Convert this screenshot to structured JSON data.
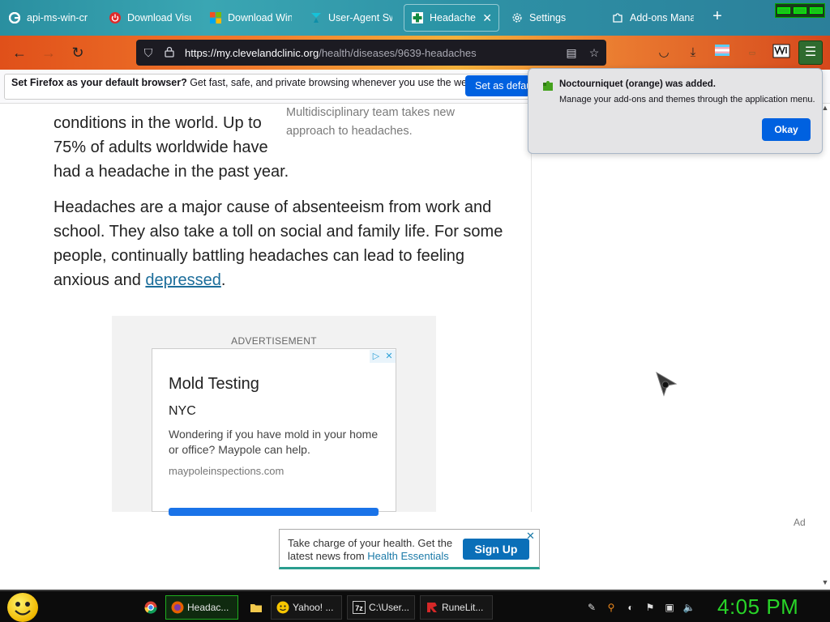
{
  "tabs": [
    {
      "label": "api-ms-win-cr",
      "icon": "google-icon"
    },
    {
      "label": "Download Visu",
      "icon": "power-icon"
    },
    {
      "label": "Download Win",
      "icon": "windows-icon"
    },
    {
      "label": "User-Agent Sw",
      "icon": "user-agent-icon"
    },
    {
      "label": "Headaches",
      "icon": "cleveland-clinic-icon",
      "close": "✕"
    },
    {
      "label": "Settings",
      "icon": "gear-icon"
    },
    {
      "label": "Add-ons Mana",
      "icon": "puzzle-icon"
    }
  ],
  "nav": {
    "url_host": "https://my.clevelandclinic.org",
    "url_path": "/health/diseases/9639-headaches"
  },
  "notification": {
    "bold": "Set Firefox as your default browser?",
    "text": " Get fast, safe, and private browsing whenever you use the web.",
    "button": "Set as default"
  },
  "popup": {
    "title": "Noctourniquet (orange) was added.",
    "body": "Manage your add-ons and themes through the application menu.",
    "button": "Okay"
  },
  "article": {
    "line1": "conditions in the world. Up to",
    "line2": "75% of adults worldwide have",
    "line3": "had a headache in the past year.",
    "caption": "Multidisciplinary team takes new approach to headaches.",
    "para2_a": "Headaches are a major cause of absenteeism from work and school. They also take a toll on social and family life. For some people, continually battling headaches can lead to feeling anxious and ",
    "para2_link": "depressed",
    "para2_end": "."
  },
  "ad": {
    "label": "ADVERTISEMENT",
    "title": "Mold Testing",
    "subtitle": "NYC",
    "desc": "Wondering if you have mold in your home or office? Maypole can help.",
    "url": "maypoleinspections.com"
  },
  "ad_tag": "Ad",
  "banner": {
    "text1": "Take charge of your health. Get the latest news from ",
    "highlight": "Health Essentials",
    "button": "Sign Up"
  },
  "taskbar": {
    "items": [
      {
        "label": "Headac...",
        "icon": "firefox-icon"
      },
      {
        "label": "Yahoo! ...",
        "icon": "yahoo-messenger-icon"
      },
      {
        "label": "C:\\User...",
        "icon": "7zip-icon"
      },
      {
        "label": "RuneLit...",
        "icon": "runelite-icon"
      }
    ],
    "clock": "4:05 PM"
  }
}
